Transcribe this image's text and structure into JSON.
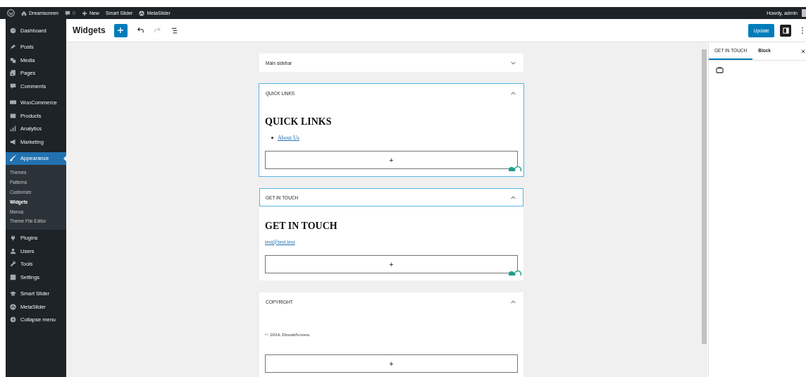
{
  "admin_bar": {
    "site": "Dreamscreen",
    "comments": "0",
    "new": "New",
    "items": [
      "Smart Slider",
      "MetaSlider"
    ],
    "greeting": "Howdy, admin"
  },
  "sidebar": {
    "groups": [
      [
        {
          "label": "Dashboard",
          "selected": false
        }
      ],
      [
        {
          "label": "Posts",
          "selected": false
        },
        {
          "label": "Media",
          "selected": false
        },
        {
          "label": "Pages",
          "selected": false
        },
        {
          "label": "Comments",
          "selected": false
        }
      ],
      [
        {
          "label": "WooCommerce",
          "selected": false
        },
        {
          "label": "Products",
          "selected": false
        },
        {
          "label": "Analytics",
          "selected": false
        },
        {
          "label": "Marketing",
          "selected": false
        }
      ],
      [
        {
          "label": "Appearance",
          "selected": true,
          "submenu": [
            {
              "label": "Themes",
              "selected": false
            },
            {
              "label": "Patterns",
              "selected": false
            },
            {
              "label": "Customize",
              "selected": false
            },
            {
              "label": "Widgets",
              "selected": true
            },
            {
              "label": "Menus",
              "selected": false
            },
            {
              "label": "Theme File Editor",
              "selected": false
            }
          ]
        },
        {
          "label": "Plugins",
          "selected": false
        },
        {
          "label": "Users",
          "selected": false
        },
        {
          "label": "Tools",
          "selected": false
        },
        {
          "label": "Settings",
          "selected": false
        }
      ],
      [
        {
          "label": "Smart Slider",
          "selected": false
        },
        {
          "label": "MetaSlider",
          "selected": false
        },
        {
          "label": "Collapse menu",
          "selected": false
        }
      ]
    ]
  },
  "header": {
    "title": "Widgets",
    "undo_disabled": false,
    "redo_disabled": true,
    "update": "Update"
  },
  "widget_areas": [
    {
      "title": "Main sidebar",
      "expanded": false,
      "selected": false,
      "header_selected": false
    },
    {
      "title": "QUICK LINKS",
      "expanded": true,
      "selected": true,
      "header_selected": false,
      "blocks": [
        {
          "kind": "heading",
          "text": "QUICK LINKS"
        },
        {
          "kind": "list",
          "items": [
            "About Us"
          ]
        },
        {
          "kind": "appender",
          "text": "+"
        }
      ]
    },
    {
      "title": "GET IN TOUCH",
      "expanded": true,
      "selected": false,
      "header_selected": true,
      "blocks": [
        {
          "kind": "heading",
          "text": "GET IN TOUCH"
        },
        {
          "kind": "link",
          "text": "test@test.test"
        },
        {
          "kind": "appender",
          "text": "+"
        }
      ]
    },
    {
      "title": "COPYRIGHT",
      "expanded": true,
      "selected": false,
      "header_selected": false,
      "blocks": [
        {
          "kind": "paragraph",
          "text": "© 2024, DreamScreen."
        },
        {
          "kind": "appender",
          "text": "+"
        }
      ]
    }
  ],
  "inspector": {
    "tabs": [
      {
        "label": "GET IN TOUCH",
        "selected": true
      },
      {
        "label": "Block",
        "selected": false
      }
    ]
  }
}
